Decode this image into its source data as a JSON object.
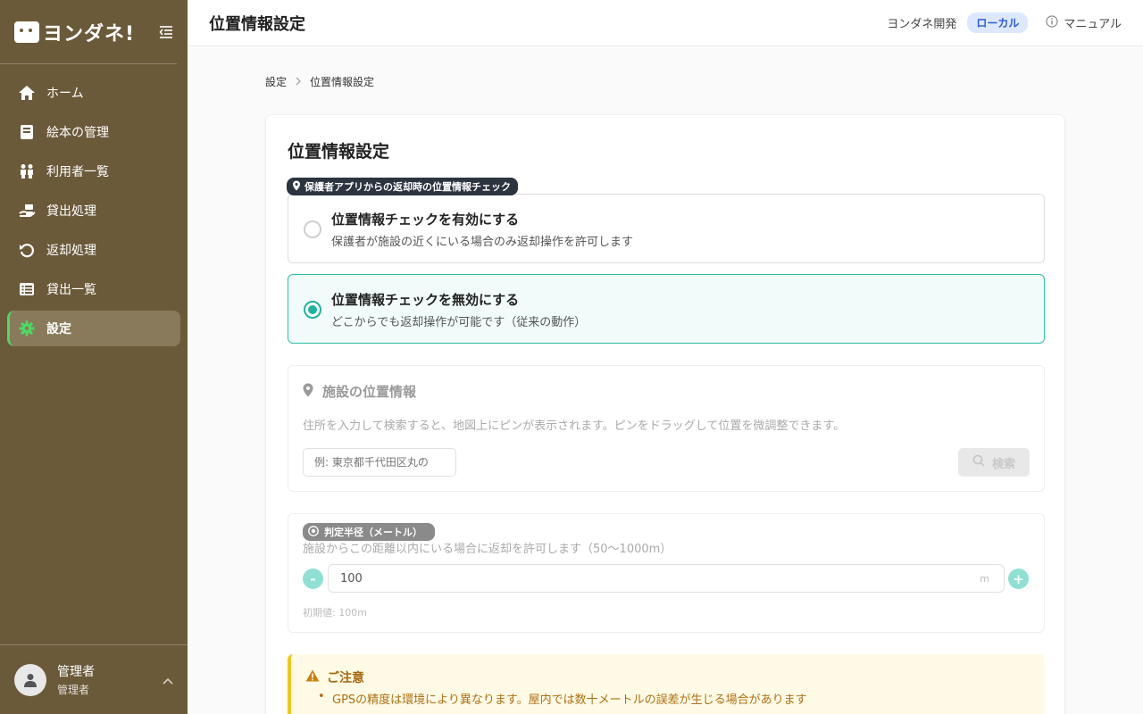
{
  "app": {
    "logo_text": "ヨンダネ!"
  },
  "sidebar": {
    "items": [
      {
        "label": "ホーム",
        "icon": "home-icon"
      },
      {
        "label": "絵本の管理",
        "icon": "book-icon"
      },
      {
        "label": "利用者一覧",
        "icon": "users-icon"
      },
      {
        "label": "貸出処理",
        "icon": "lend-icon"
      },
      {
        "label": "返却処理",
        "icon": "return-icon"
      },
      {
        "label": "貸出一覧",
        "icon": "list-icon"
      },
      {
        "label": "設定",
        "icon": "gear-icon",
        "active": true
      }
    ],
    "user": {
      "name": "管理者",
      "role": "管理者"
    }
  },
  "header": {
    "title": "位置情報設定",
    "org": "ヨンダネ開発",
    "env_badge": "ローカル",
    "manual": "マニュアル"
  },
  "breadcrumb": {
    "parent": "設定",
    "current": "位置情報設定"
  },
  "card": {
    "title": "位置情報設定",
    "section_label": "保護者アプリからの返却時の位置情報チェック",
    "options": [
      {
        "title": "位置情報チェックを有効にする",
        "desc": "保護者が施設の近くにいる場合のみ返却操作を許可します",
        "selected": false
      },
      {
        "title": "位置情報チェックを無効にする",
        "desc": "どこからでも返却操作が可能です（従来の動作）",
        "selected": true
      }
    ],
    "location": {
      "title": "施設の位置情報",
      "desc": "住所を入力して検索すると、地図上にピンが表示されます。ピンをドラッグして位置を微調整できます。",
      "placeholder": "例: 東京都千代田区丸の",
      "search_label": "検索"
    },
    "radius": {
      "label": "判定半径（メートル）",
      "desc": "施設からこの距離以内にいる場合に返却を許可します（50〜1000m）",
      "value": "100",
      "unit": "m",
      "minus": "-",
      "plus": "+",
      "default": "初期値: 100m"
    },
    "notice": {
      "title": "ご注意",
      "items": [
        "GPSの精度は環境により異なります。屋内では数十メートルの誤差が生じる場合があります"
      ]
    }
  },
  "colors": {
    "sidebar": "#6b5a3a",
    "accent": "#1db49c",
    "active_bar": "#4cd964"
  }
}
